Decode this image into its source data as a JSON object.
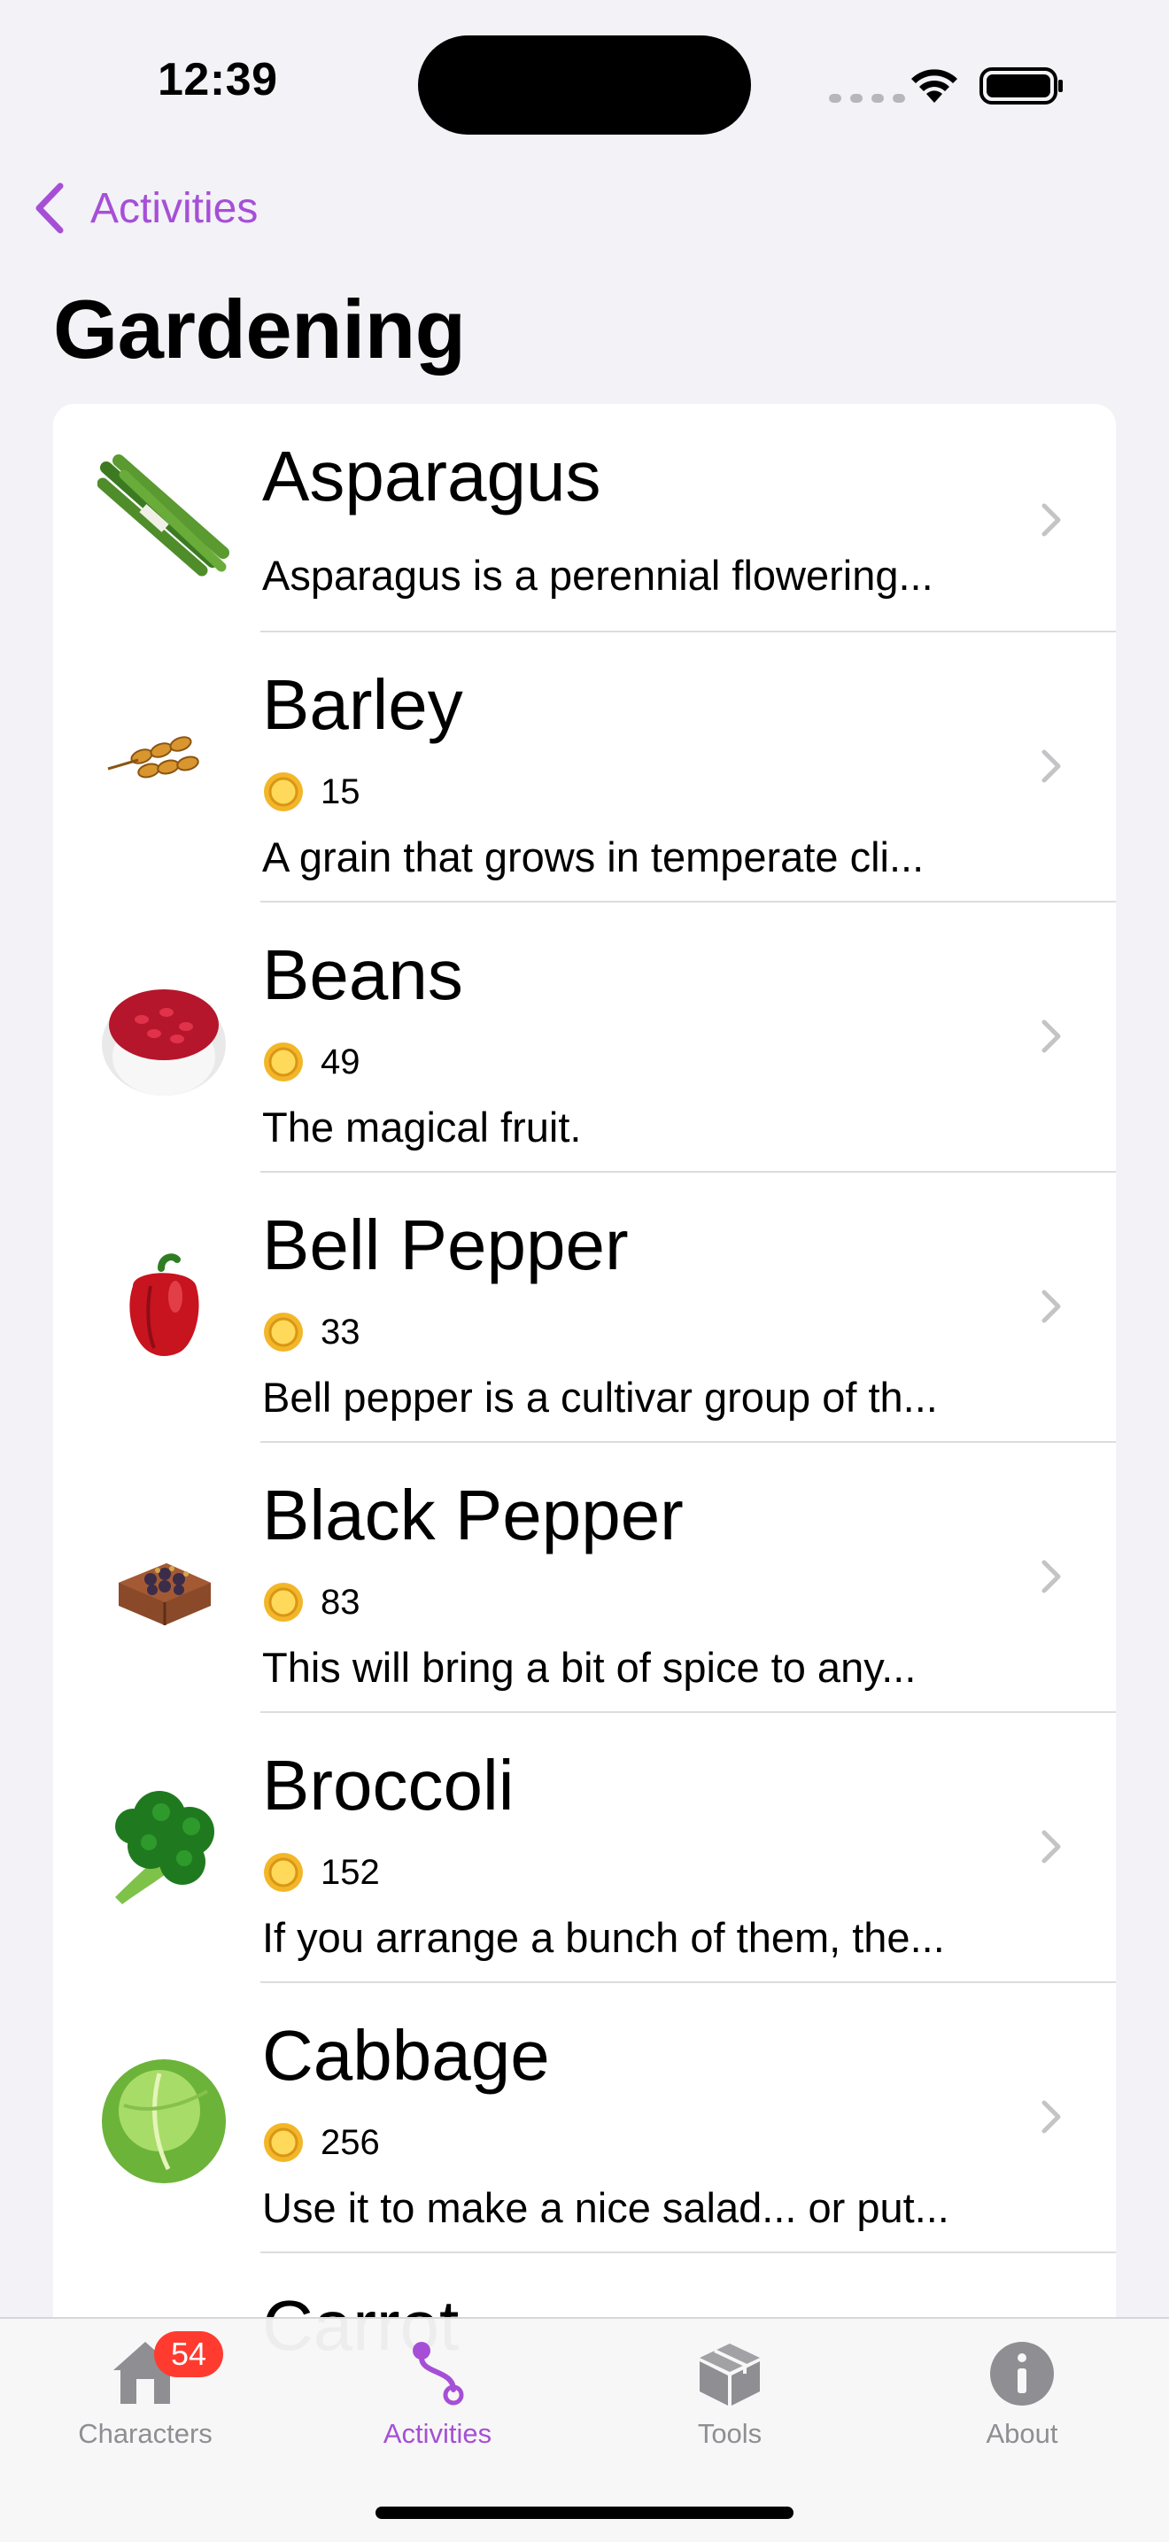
{
  "status_bar": {
    "time": "12:39"
  },
  "nav": {
    "back_label": "Activities",
    "title": "Gardening"
  },
  "items": [
    {
      "name": "Asparagus",
      "price": "",
      "description": "Asparagus is a perennial flowering..."
    },
    {
      "name": "Barley",
      "price": "15",
      "description": "A grain that grows in temperate cli..."
    },
    {
      "name": "Beans",
      "price": "49",
      "description": "The magical fruit."
    },
    {
      "name": "Bell Pepper",
      "price": "33",
      "description": "Bell pepper is a cultivar group of th..."
    },
    {
      "name": "Black Pepper",
      "price": "83",
      "description": "This will bring a bit of spice to any..."
    },
    {
      "name": "Broccoli",
      "price": "152",
      "description": "If you arrange a bunch of them, the..."
    },
    {
      "name": "Cabbage",
      "price": "256",
      "description": "Use it to make a nice salad... or put..."
    },
    {
      "name": "Carrot",
      "price": "",
      "description": ""
    }
  ],
  "tabbar": {
    "tabs": [
      {
        "label": "Characters",
        "badge": "54"
      },
      {
        "label": "Activities"
      },
      {
        "label": "Tools"
      },
      {
        "label": "About"
      }
    ]
  },
  "colors": {
    "accent": "#a64fd6",
    "badge": "#ff3b30",
    "background": "#f2f2f7"
  }
}
